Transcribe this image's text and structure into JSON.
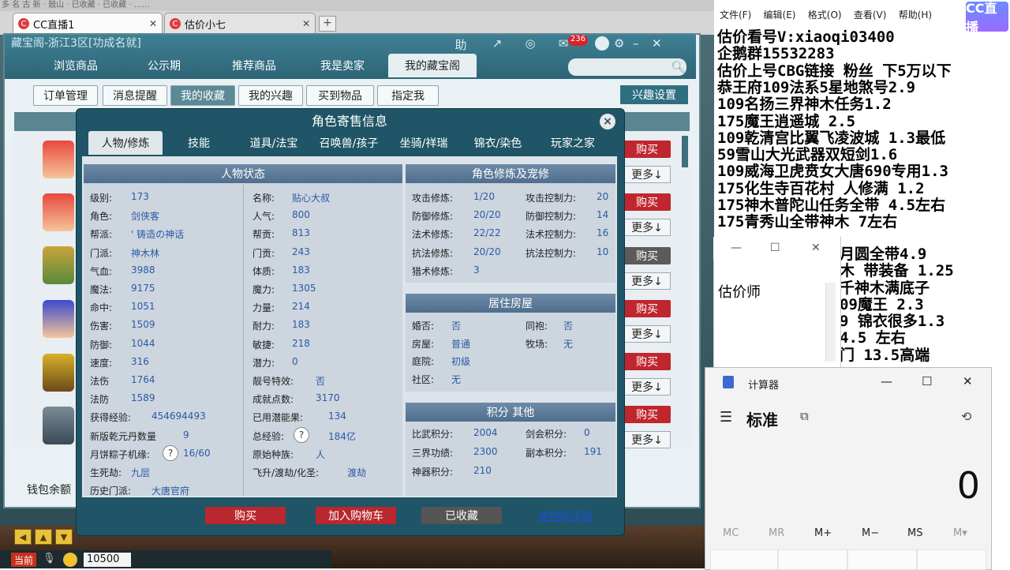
{
  "browser": {
    "topbar_text": "多 名 古 新 · 鼓山 · 已收藏 · 已收藏 · ……",
    "tabs": [
      {
        "label": "CC直播1"
      },
      {
        "label": "估价小七"
      }
    ]
  },
  "game": {
    "window_title": "藏宝阁-浙江3区[功成名就]",
    "top_icons": [
      "助",
      "↗",
      "◎",
      "✉"
    ],
    "mail_badge": "236",
    "tabs": [
      "浏览商品",
      "公示期",
      "推荐商品",
      "我是卖家",
      "我的藏宝阁"
    ],
    "active_tab": 4,
    "subtabs": [
      "订单管理",
      "消息提醒",
      "我的收藏",
      "我的兴趣",
      "买到物品",
      "指定我"
    ],
    "active_subtab": 2,
    "interest_button": "兴趣设置",
    "buy_label": "购买",
    "more_label": "更多↓",
    "wallet_text": "钱包余额",
    "chat_channel": "当前",
    "chat_input": "10500"
  },
  "dialog": {
    "title": "角色寄售信息",
    "close": "×",
    "tabs": [
      "人物/修炼",
      "技能",
      "道具/法宝",
      "召唤兽/孩子",
      "坐骑/祥瑞",
      "锦衣/染色",
      "玩家之家"
    ],
    "active_tab": 0,
    "status": {
      "title": "人物状态",
      "left": [
        {
          "label": "级别:",
          "value": "173"
        },
        {
          "label": "角色:",
          "value": "剑侠客"
        },
        {
          "label": "帮派:",
          "value": "' 铸造の神话"
        },
        {
          "label": "门派:",
          "value": "神木林"
        },
        {
          "label": "气血:",
          "value": "3988"
        },
        {
          "label": "魔法:",
          "value": "9175"
        },
        {
          "label": "命中:",
          "value": "1051"
        },
        {
          "label": "伤害:",
          "value": "1509"
        },
        {
          "label": "防御:",
          "value": "1044"
        },
        {
          "label": "速度:",
          "value": "316"
        },
        {
          "label": "法伤",
          "value": "1764"
        },
        {
          "label": "法防",
          "value": "1589"
        },
        {
          "label": "获得经验:",
          "value": "454694493"
        },
        {
          "label": "新版乾元丹数量",
          "value": "9"
        },
        {
          "label": "月饼粽子机缘:",
          "value": "16/60"
        },
        {
          "label": "生死劫:",
          "value": "九层"
        },
        {
          "label": "历史门派:",
          "value": "大唐官府"
        }
      ],
      "right": [
        {
          "label": "名称:",
          "value": "贴心大叔"
        },
        {
          "label": "人气:",
          "value": "800"
        },
        {
          "label": "帮贡:",
          "value": "813"
        },
        {
          "label": "门贡:",
          "value": "243"
        },
        {
          "label": "体质:",
          "value": "183"
        },
        {
          "label": "魔力:",
          "value": "1305"
        },
        {
          "label": "力量:",
          "value": "214"
        },
        {
          "label": "耐力:",
          "value": "183"
        },
        {
          "label": "敏捷:",
          "value": "218"
        },
        {
          "label": "潜力:",
          "value": "0"
        },
        {
          "label": "靓号特效:",
          "value": "否"
        },
        {
          "label": "成就点数:",
          "value": "3170"
        },
        {
          "label": "已用潜能果:",
          "value": "134"
        },
        {
          "label": "总经验:",
          "value": "184亿"
        },
        {
          "label": "原始种族:",
          "value": "人"
        },
        {
          "label": "飞升/渡劫/化圣:",
          "value": "渡劫"
        }
      ]
    },
    "cultivation": {
      "title": "角色修炼及宠修",
      "left": [
        {
          "label": "攻击修炼:",
          "value": "1/20"
        },
        {
          "label": "防御修炼:",
          "value": "20/20"
        },
        {
          "label": "法术修炼:",
          "value": "22/22"
        },
        {
          "label": "抗法修炼:",
          "value": "20/20"
        },
        {
          "label": "猎术修炼:",
          "value": "3"
        }
      ],
      "right": [
        {
          "label": "攻击控制力:",
          "value": "20"
        },
        {
          "label": "防御控制力:",
          "value": "14"
        },
        {
          "label": "法术控制力:",
          "value": "16"
        },
        {
          "label": "抗法控制力:",
          "value": "10"
        }
      ]
    },
    "house": {
      "title": "居住房屋",
      "left": [
        {
          "label": "婚否:",
          "value": "否"
        },
        {
          "label": "房屋:",
          "value": "普通"
        },
        {
          "label": "庭院:",
          "value": "初级"
        },
        {
          "label": "社区:",
          "value": "无"
        }
      ],
      "right": [
        {
          "label": "同袍:",
          "value": "否"
        },
        {
          "label": "牧场:",
          "value": "无"
        }
      ]
    },
    "points": {
      "title": "积分 其他",
      "left": [
        {
          "label": "比武积分:",
          "value": "2004"
        },
        {
          "label": "三界功绩:",
          "value": "2300"
        },
        {
          "label": "神器积分:",
          "value": "210"
        }
      ],
      "right": [
        {
          "label": "剑会积分:",
          "value": "0"
        },
        {
          "label": "副本积分:",
          "value": "191"
        }
      ]
    },
    "buttons": {
      "buy": "购买",
      "add_cart": "加入购物车",
      "favorited": "已收藏",
      "web": "使用网页版"
    },
    "question_mark": "?"
  },
  "notepad": {
    "menu": [
      "文件(F)",
      "编辑(E)",
      "格式(O)",
      "查看(V)",
      "帮助(H)"
    ],
    "lines": [
      "估价看号V:xiaoqi03400",
      "企鹅群15532283",
      "估价上号CBG链接 粉丝 下5万以下",
      "恭王府109法系5星地煞号2.9",
      "109名扬三界神木任务1.2",
      "175魔王逍遥城 2.5",
      "109乾清宫比翼飞凌波城 1.3最低",
      "59雪山大光武器双短剑1.6",
      "109威海卫虎贲女大唐690专用1.3",
      "175化生寺百花村 人修满 1.2",
      "175神木普陀山任务全带 4.5左右",
      "175青秀山全带神木  7左右",
      "月圆全带4.9",
      "木 带装备  1.25",
      "千神木满底子",
      "09魔王 2.3",
      "9  锦衣很多1.3",
      "4.5 左右",
      "门  13.5高端"
    ],
    "logo": "CC直播"
  },
  "estimator": {
    "title": "估价师"
  },
  "calculator": {
    "app_name": "计算器",
    "mode": "标准",
    "display": "0",
    "memory": [
      "MC",
      "MR",
      "M+",
      "M−",
      "MS",
      "M▾"
    ]
  }
}
